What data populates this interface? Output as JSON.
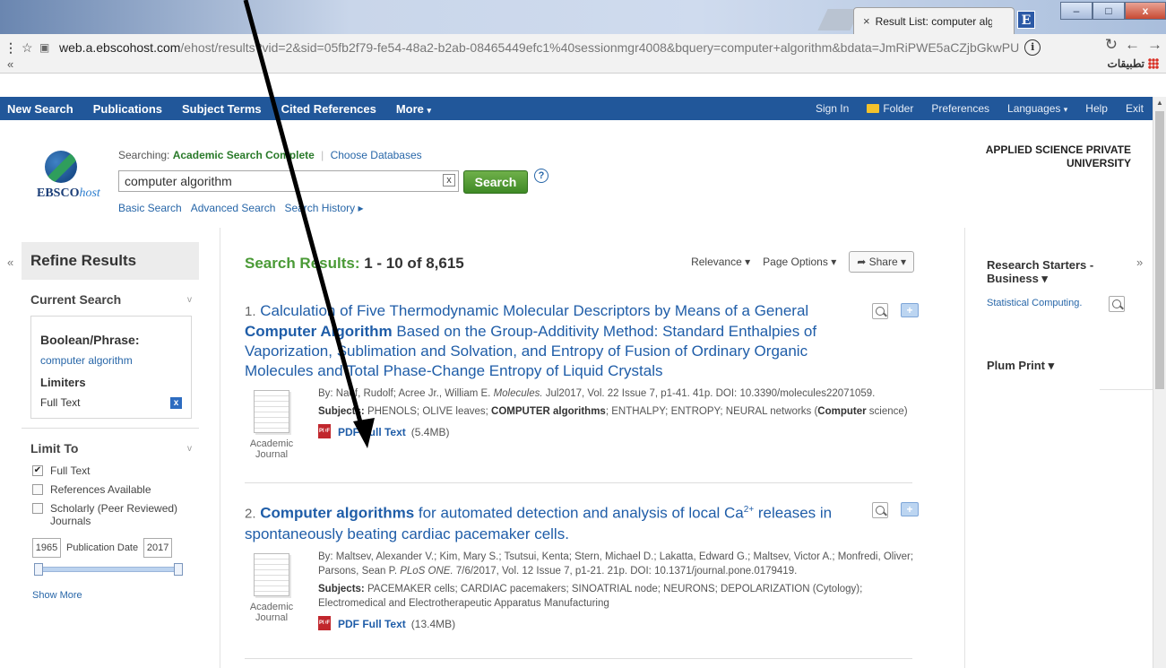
{
  "browser": {
    "tab_close": "×",
    "tab_title": "Result List: computer alg",
    "ext_label": "E",
    "win_min": "–",
    "win_max": "□",
    "win_close": "x",
    "menu_dots": "⋮",
    "star": "☆",
    "url_host": "web.a.ebscohost.com",
    "url_path": "/ehost/results?vid=2&sid=05fb2f79-fe54-48a2-b2ab-08465449efc1%40sessionmgr4008&bquery=computer+algorithm&bdata=JmRiPWE5aCZjbGkwPU",
    "info_icon": "i",
    "reload": "↻",
    "back": "←",
    "forward": "→",
    "bookmarks_chevron": "«",
    "apps_label": "تطبيقات"
  },
  "nav": {
    "left": [
      "New Search",
      "Publications",
      "Subject Terms",
      "Cited References",
      "More"
    ],
    "more_caret": "▾",
    "sign_in": "Sign In",
    "folder": "Folder",
    "preferences": "Preferences",
    "languages": "Languages",
    "help": "Help",
    "exit": "Exit"
  },
  "header": {
    "logo_bold": "EBSCO",
    "logo_italic": "host",
    "searching_label": "Searching:",
    "database": "Academic Search Complete",
    "separator": "|",
    "choose_db": "Choose Databases",
    "query": "computer algorithm",
    "clear": "x",
    "search_button": "Search",
    "help_icon": "?",
    "basic_search": "Basic Search",
    "advanced_search": "Advanced Search",
    "search_history": "Search History ▸",
    "institution_line1": "APPLIED SCIENCE PRIVATE",
    "institution_line2": "UNIVERSITY"
  },
  "refine": {
    "collapse": "«",
    "title": "Refine Results",
    "current_search": "Current Search",
    "boolean_phrase": "Boolean/Phrase:",
    "term": "computer algorithm",
    "limiters": "Limiters",
    "full_text": "Full Text",
    "remove": "x",
    "limit_to": "Limit To",
    "chevron": "v",
    "options": [
      {
        "label": "Full Text",
        "checked": true
      },
      {
        "label": "References Available",
        "checked": false
      },
      {
        "label": "Scholarly (Peer Reviewed) Journals",
        "checked": false
      }
    ],
    "checkmark": "✔",
    "date_from": "1965",
    "date_label": "Publication Date",
    "date_to": "2017",
    "slider_low": 0.0,
    "slider_high": 1.0,
    "show_more": "Show More"
  },
  "results": {
    "heading_label": "Search Results:",
    "heading_range": "1 - 10 of 8,615",
    "relevance": "Relevance ▾",
    "page_options": "Page Options ▾",
    "share": "➦ Share ▾",
    "items": [
      {
        "num": "1.",
        "title_a": "Calculation of Five Thermodynamic Molecular Descriptors by Means of a General ",
        "title_bold": "Computer Algorithm",
        "title_b": " Based on the Group-Additivity Method: Standard Enthalpies of Vaporization, Sublimation and Solvation, and Entropy of Fusion of Ordinary Organic Molecules and Total Phase-Change Entropy of Liquid Crystals",
        "byline_a": "By: Naef, Rudolf; Acree Jr., William E. ",
        "journal": "Molecules.",
        "byline_b": " Jul2017, Vol. 22 Issue 7, p1-41. 41p. DOI: 10.3390/molecules22071059.",
        "subjects_label": "Subjects:",
        "subjects_a": " PHENOLS; OLIVE leaves; ",
        "subjects_bold": "COMPUTER algorithms",
        "subjects_b": "; ENTHALPY; ENTROPY; NEURAL networks (",
        "subjects_bold2": "Computer",
        "subjects_c": " science)",
        "type_line1": "Academic",
        "type_line2": "Journal",
        "pdf_label": "PDF Full Text",
        "pdf_size": "(5.4MB)"
      },
      {
        "num": "2.",
        "title_bold": "Computer algorithms",
        "title_a": " for automated detection and analysis of local Ca",
        "title_sup": "2+",
        "title_b": " releases in spontaneously beating cardiac pacemaker cells.",
        "byline_a": "By: Maltsev, Alexander V.; Kim, Mary S.; Tsutsui, Kenta; Stern, Michael D.; Lakatta, Edward G.; Maltsev, Victor A.; Monfredi, Oliver; Parsons, Sean P. ",
        "journal": "PLoS ONE.",
        "byline_b": " 7/6/2017, Vol. 12 Issue 7, p1-21. 21p. DOI: 10.1371/journal.pone.0179419.",
        "subjects_label": "Subjects:",
        "subjects_a": " PACEMAKER cells; CARDIAC pacemakers; SINOATRIAL node; NEURONS; DEPOLARIZATION (Cytology); Electromedical and Electrotherapeutic Apparatus Manufacturing",
        "type_line1": "Academic",
        "type_line2": "Journal",
        "pdf_label": "PDF Full Text",
        "pdf_size": "(13.4MB)"
      }
    ]
  },
  "sidebar_right": {
    "collapse": "»",
    "research_starters": "Research Starters - Business ▾",
    "starter_link": "Statistical Computing.",
    "plum_print": "Plum Print ▾"
  },
  "colors": {
    "nav_bg": "#21579a",
    "accent_green": "#4a9a36",
    "link_blue": "#1f5da8"
  }
}
